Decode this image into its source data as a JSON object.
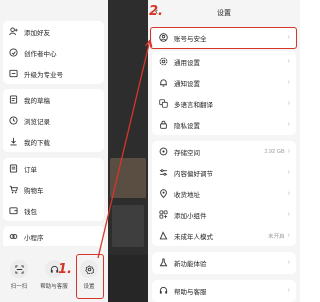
{
  "drawer": {
    "items": [
      {
        "label": "添加好友",
        "icon": "add-friend-icon"
      },
      {
        "label": "创作者中心",
        "icon": "creator-icon"
      },
      {
        "label": "升级为专业号",
        "icon": "upgrade-icon"
      },
      {
        "label": "我的草稿",
        "icon": "draft-icon"
      },
      {
        "label": "浏览记录",
        "icon": "history-icon"
      },
      {
        "label": "我的下载",
        "icon": "download-icon"
      },
      {
        "label": "订单",
        "icon": "order-icon"
      },
      {
        "label": "购物车",
        "icon": "cart-icon"
      },
      {
        "label": "钱包",
        "icon": "wallet-icon"
      },
      {
        "label": "小程序",
        "icon": "mini-program-icon"
      }
    ],
    "bottom": [
      {
        "label": "扫一扫",
        "icon": "scan-icon"
      },
      {
        "label": "帮助与客服",
        "icon": "headset-icon"
      },
      {
        "label": "设置",
        "icon": "gear-icon"
      }
    ]
  },
  "strip": {
    "snippet_1": "…"
  },
  "settings": {
    "title": "设置",
    "items": [
      {
        "label": "账号与安全",
        "icon": "user-icon"
      },
      {
        "label": "通用设置",
        "icon": "gear-icon"
      },
      {
        "label": "通知设置",
        "icon": "bell-icon"
      },
      {
        "label": "多语言和翻译",
        "icon": "translate-icon"
      },
      {
        "label": "隐私设置",
        "icon": "lock-icon"
      },
      {
        "label": "存储空间",
        "icon": "storage-icon",
        "value": "2.92 GB"
      },
      {
        "label": "内容偏好调节",
        "icon": "sliders-icon"
      },
      {
        "label": "收货地址",
        "icon": "location-icon"
      },
      {
        "label": "添加小组件",
        "icon": "widget-icon"
      },
      {
        "label": "未成年人模式",
        "icon": "teen-mode-icon",
        "value": "未开启"
      },
      {
        "label": "新功能体验",
        "icon": "flask-icon"
      },
      {
        "label": "帮助与客服",
        "icon": "headset-icon"
      }
    ]
  },
  "annotations": {
    "step1": "1.",
    "step2": "2.",
    "color": "#d8352a"
  }
}
